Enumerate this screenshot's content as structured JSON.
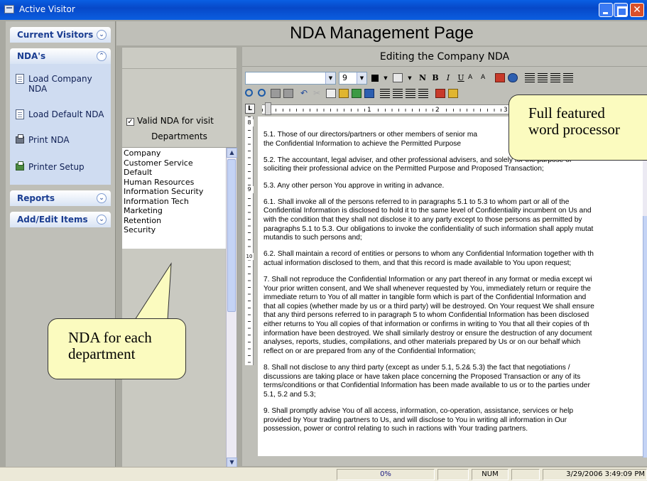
{
  "window": {
    "title": "Active Visitor"
  },
  "nav": {
    "groups": [
      {
        "label": "Current Visitors",
        "chevron": "down"
      },
      {
        "label": "NDA's",
        "chevron": "up",
        "items": [
          {
            "label": "Load Company NDA",
            "icon": "document-icon"
          },
          {
            "label": "Load Default NDA",
            "icon": "document-icon"
          },
          {
            "label": "Print NDA",
            "icon": "printer-icon"
          },
          {
            "label": "Printer Setup",
            "icon": "printer-setup-icon"
          }
        ]
      },
      {
        "label": "Reports",
        "chevron": "down"
      },
      {
        "label": "Add/Edit Items",
        "chevron": "down"
      }
    ]
  },
  "page": {
    "title": "NDA Management Page"
  },
  "middle": {
    "valid_nda_label": "Valid NDA for visit",
    "valid_nda_checked": true,
    "departments_title": "Departments",
    "departments": [
      "Company",
      "Customer Service",
      "Default",
      "Human Resources",
      "Information Security",
      "Information Tech",
      "Marketing",
      "Retention",
      "Security"
    ]
  },
  "editor": {
    "title": "Editing the Company NDA",
    "font_size": "9",
    "toolbar_letters": {
      "n": "N",
      "b": "B",
      "i": "I",
      "u": "U"
    },
    "ruler_corner": "L",
    "ruler_numbers": [
      "1",
      "2",
      "3"
    ],
    "vruler_numbers": [
      "8",
      "9",
      "10"
    ],
    "paragraphs": [
      "5.1. Those of our directors/partners or other members of senior ma\nthe Confidential Information to achieve the Permitted Purpose",
      "5.2. The accountant, legal adviser, and other professional advisers, and solely for the purpose of\nsoliciting their professional advice on the Permitted Purpose and Proposed Transaction;",
      "5.3. Any other person You approve in writing in advance.",
      "6.1. Shall invoke all of the persons referred to in paragraphs 5.1 to 5.3 to whom part or all of the\nConfidential Information is disclosed to hold it to the same level of Confidentiality incumbent on Us and\nwith the condition that they shall not disclose it to any party except to those persons as permitted by\nparagraphs 5.1 to 5.3. Our obligations to invoke the confidentiality of such information shall apply mutat\nmutandis to such persons and;",
      "6.2. Shall maintain a record of entities or persons to whom any Confidential Information together with th\nactual information disclosed to them, and that this record is made available to You upon request;",
      "7. Shall not reproduce the Confidential Information or any part thereof in any format or media except wi\nYour prior written consent, and We shall whenever requested by You, immediately return or require the\nimmediate return to You of all matter in tangible form which is part of the Confidential Information and\nthat all copies (whether made by us or a third party) will be destroyed. On Your request We shall ensure\nthat any third persons referred to in paragraph 5 to whom Confidential Information has been disclosed\neither returns to You all copies of that information or confirms in writing to You that all their copies of th\ninformation have been destroyed. We shall similarly destroy or ensure the destruction of any document\nanalyses, reports, studies, compilations, and other materials prepared by Us or on our behalf which\nreflect on or are prepared from any of the Confidential Information;",
      "8. Shall not disclose to any third party (except as under 5.1, 5.2& 5.3) the fact that negotiations /\ndiscussions are taking place or have taken place concerning the Proposed Transaction or any of its\nterms/conditions or that Confidential Information has been made available to us or to the parties under\n5.1, 5.2 and 5.3;",
      "9. Shall promptly advise You of all access, information, co-operation, assistance, services or help\nprovided by Your trading partners to Us, and will disclose to You in writing all information in Our\npossession, power or control relating to such in  ractions with Your trading partners."
    ]
  },
  "status": {
    "progress": "0%",
    "num": "NUM",
    "datetime": "3/29/2006 3:49:09 PM"
  },
  "callouts": {
    "nda_per_department": "NDA for each\ndepartment",
    "word_processor": "Full featured\nword processor"
  },
  "colors": {
    "title_bar": "#0748c8",
    "nav_header_text": "#1a3d91",
    "nav_body": "#cfdcf1",
    "callout_fill": "#fbfbbf"
  }
}
